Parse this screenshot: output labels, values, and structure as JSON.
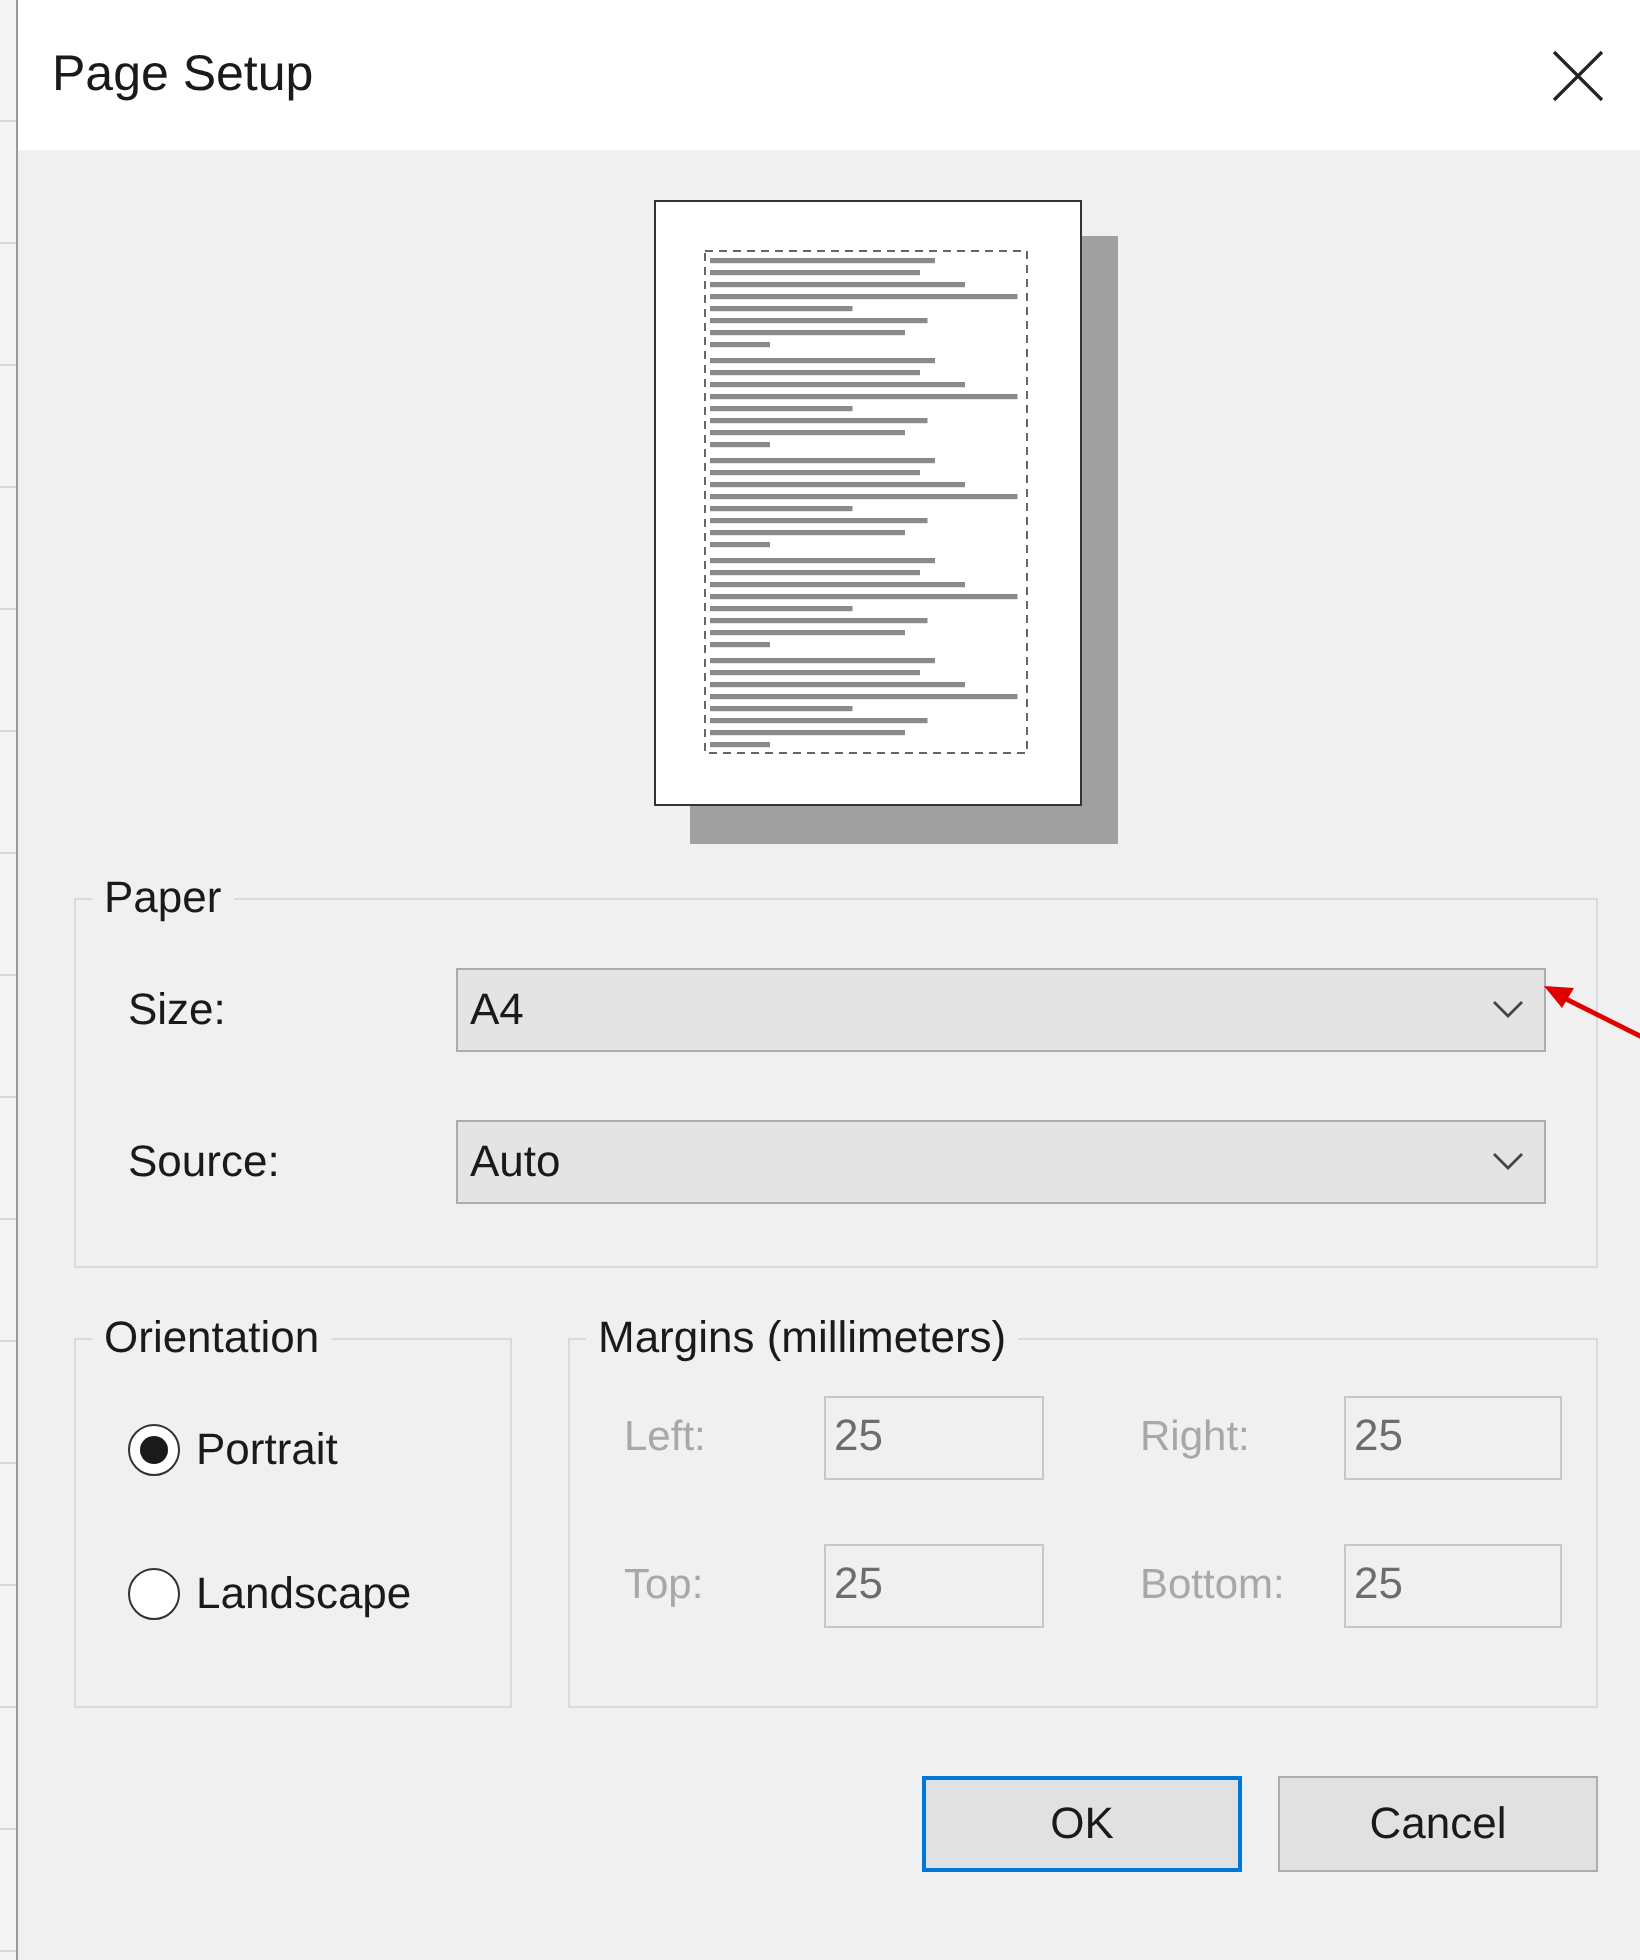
{
  "window": {
    "title": "Page Setup"
  },
  "paper": {
    "legend": "Paper",
    "fields": [
      {
        "label": "Size:",
        "value": "A4"
      },
      {
        "label": "Source:",
        "value": "Auto"
      }
    ]
  },
  "orientation": {
    "legend": "Orientation",
    "options": [
      {
        "label": "Portrait",
        "selected": true
      },
      {
        "label": "Landscape",
        "selected": false
      }
    ]
  },
  "margins": {
    "legend": "Margins (millimeters)",
    "disabled": true,
    "fields": [
      {
        "label": "Left:",
        "value": "25"
      },
      {
        "label": "Right:",
        "value": "25"
      },
      {
        "label": "Top:",
        "value": "25"
      },
      {
        "label": "Bottom:",
        "value": "25"
      }
    ]
  },
  "buttons": [
    {
      "label": "OK",
      "default": true
    },
    {
      "label": "Cancel",
      "default": false
    }
  ]
}
